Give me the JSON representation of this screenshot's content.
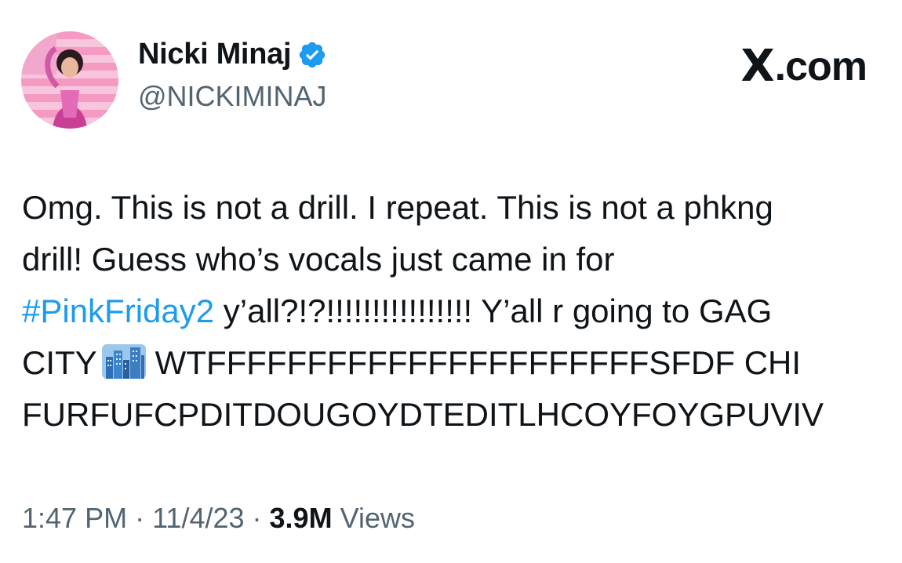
{
  "author": {
    "display_name": "Nicki Minaj",
    "handle": "@NICKIMINAJ",
    "verified": true,
    "avatar_icon": "profile-avatar"
  },
  "brand": {
    "logo_text": ".com",
    "logo_glyph": "X"
  },
  "tweet": {
    "line1": "Omg. This is not a drill. I repeat. This is not a phkng",
    "line2": "drill! Guess who’s vocals just came in for",
    "hashtag": "#PinkFriday2",
    "line3_rest": " y’all?!?!!!!!!!!!!!!!!!! Y’all r going to GAG",
    "line4_start": "CITY",
    "emoji": "city-skyline-emoji",
    "line4_rest": "WTFFFFFFFFFFFFFFFFFFFFFFSFDF CHI",
    "line5": "FURFUFCPDITDOUGOYDTEDITLHCOYFOYGPUVIV"
  },
  "meta": {
    "time": "1:47 PM",
    "sep1": " · ",
    "date": "11/4/23",
    "sep2": " · ",
    "views_count": "3.9M",
    "views_label": " Views"
  },
  "colors": {
    "link": "#1d9bf0",
    "verified": "#1d9bf0",
    "secondary_text": "#536471",
    "primary_text": "#0f1419"
  }
}
